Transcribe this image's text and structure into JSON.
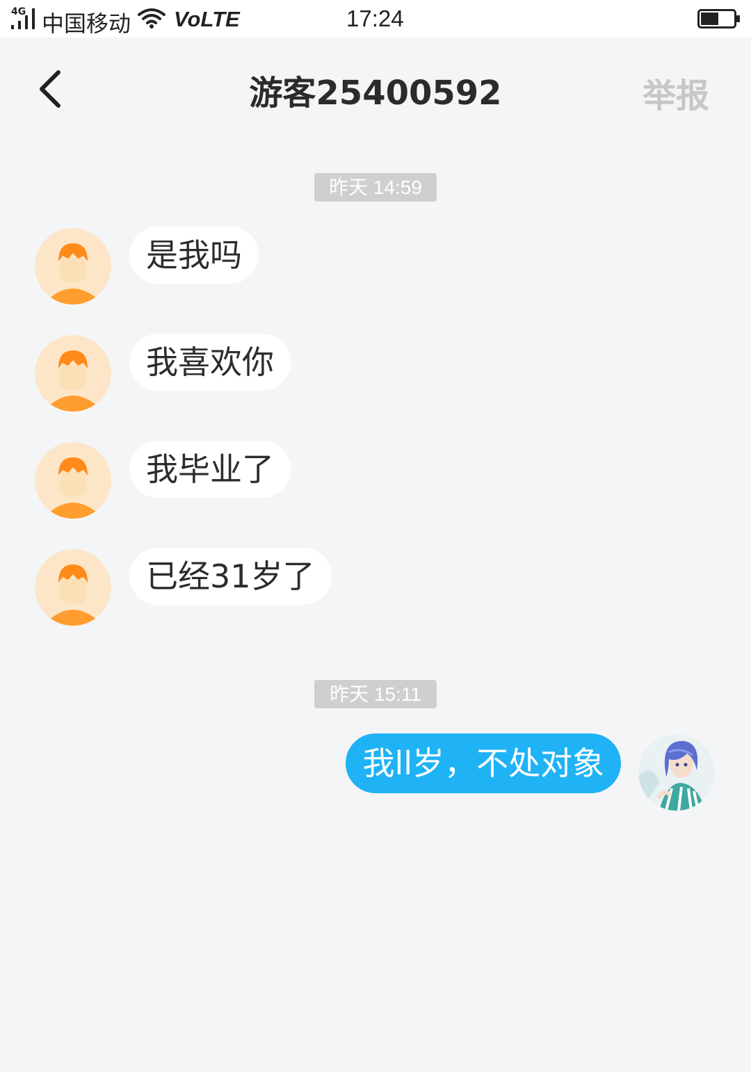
{
  "status_bar": {
    "network": "4G",
    "carrier": "中国移动",
    "volte": "VoLTE",
    "time": "17:24",
    "battery_level": 0.55
  },
  "header": {
    "back_icon": "chevron-left-icon",
    "title": "游客25400592",
    "report_label": "举报"
  },
  "chat": {
    "groups": [
      {
        "timestamp": "昨天 14:59",
        "messages": [
          {
            "direction": "incoming",
            "text": "是我吗"
          },
          {
            "direction": "incoming",
            "text": "我喜欢你"
          },
          {
            "direction": "incoming",
            "text": "我毕业了"
          },
          {
            "direction": "incoming",
            "text": "已经31岁了"
          }
        ]
      },
      {
        "timestamp": "昨天 15:11",
        "messages": [
          {
            "direction": "outgoing",
            "text": "我ll岁，不处对象"
          }
        ]
      }
    ]
  },
  "colors": {
    "background": "#f4f5f7",
    "outgoing_bubble": "#1fb3f5",
    "incoming_bubble": "#ffffff",
    "timestamp_bg": "#cfcfcf",
    "report_text": "#c7c7c7",
    "avatar_orange": "#ff9d2e"
  }
}
